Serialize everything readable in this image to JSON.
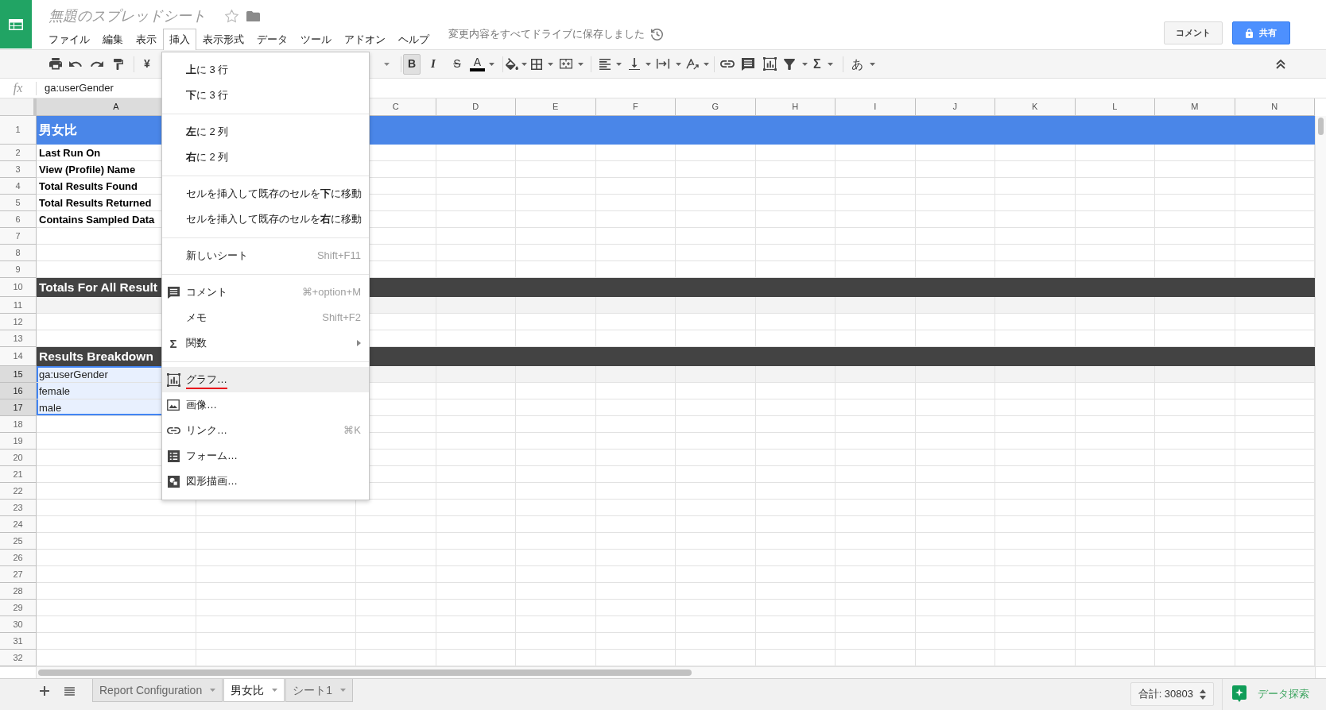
{
  "document": {
    "title": "無題のスプレッドシート",
    "starred": false,
    "save_status": "変更内容をすべてドライブに保存しました"
  },
  "menubar": [
    {
      "label": "ファイル",
      "open": false
    },
    {
      "label": "編集",
      "open": false
    },
    {
      "label": "表示",
      "open": false
    },
    {
      "label": "挿入",
      "open": true
    },
    {
      "label": "表示形式",
      "open": false
    },
    {
      "label": "データ",
      "open": false
    },
    {
      "label": "ツール",
      "open": false
    },
    {
      "label": "アドオン",
      "open": false
    },
    {
      "label": "ヘルプ",
      "open": false
    }
  ],
  "header_buttons": {
    "comment": "コメント",
    "share": "共有"
  },
  "toolbar": {
    "currency": "¥",
    "format_buttons": [
      {
        "kind": "bold",
        "glyph": "B",
        "active": true
      },
      {
        "kind": "italic",
        "glyph": "I",
        "active": false
      },
      {
        "kind": "strike",
        "glyph": "S",
        "active": false
      }
    ],
    "text_color": {
      "glyph": "A",
      "color": "#000000"
    },
    "functions_glyph": "Σ",
    "input_tools_glyph": "あ"
  },
  "formula_bar": {
    "label": "fx",
    "value": "ga:userGender"
  },
  "columns": [
    {
      "label": "A",
      "selected": true
    },
    {
      "label": "C",
      "selected": false
    },
    {
      "label": "D",
      "selected": false
    },
    {
      "label": "E",
      "selected": false
    },
    {
      "label": "F",
      "selected": false
    },
    {
      "label": "G",
      "selected": false
    },
    {
      "label": "H",
      "selected": false
    },
    {
      "label": "I",
      "selected": false
    },
    {
      "label": "J",
      "selected": false
    },
    {
      "label": "K",
      "selected": false
    },
    {
      "label": "L",
      "selected": false
    },
    {
      "label": "M",
      "selected": false
    },
    {
      "label": "N",
      "selected": false
    }
  ],
  "rows": [
    {
      "number": "1",
      "kind": "title",
      "selected": false,
      "value": "男女比"
    },
    {
      "number": "2",
      "kind": "label",
      "selected": false,
      "value": "Last Run On"
    },
    {
      "number": "3",
      "kind": "label",
      "selected": false,
      "value": "View (Profile) Name"
    },
    {
      "number": "4",
      "kind": "label",
      "selected": false,
      "value": "Total Results Found"
    },
    {
      "number": "5",
      "kind": "label",
      "selected": false,
      "value": "Total Results Returned"
    },
    {
      "number": "6",
      "kind": "label",
      "selected": false,
      "value": "Contains Sampled Data"
    },
    {
      "number": "7",
      "kind": "plain",
      "selected": false
    },
    {
      "number": "8",
      "kind": "plain",
      "selected": false
    },
    {
      "number": "9",
      "kind": "plain",
      "selected": false
    },
    {
      "number": "10",
      "kind": "section",
      "selected": false,
      "value": "Totals For All Result"
    },
    {
      "number": "11",
      "kind": "shaded",
      "selected": false
    },
    {
      "number": "12",
      "kind": "plain",
      "selected": false
    },
    {
      "number": "13",
      "kind": "plain",
      "selected": false
    },
    {
      "number": "14",
      "kind": "section",
      "selected": false,
      "value": "Results Breakdown"
    },
    {
      "number": "15",
      "kind": "shaded",
      "selected": true,
      "value": "ga:userGender"
    },
    {
      "number": "16",
      "kind": "plain",
      "selected": true,
      "value": "female"
    },
    {
      "number": "17",
      "kind": "plain",
      "selected": true,
      "value": "male"
    },
    {
      "number": "18",
      "kind": "plain",
      "selected": false
    },
    {
      "number": "19",
      "kind": "plain",
      "selected": false
    },
    {
      "number": "20",
      "kind": "plain",
      "selected": false
    },
    {
      "number": "21",
      "kind": "plain",
      "selected": false
    },
    {
      "number": "22",
      "kind": "plain",
      "selected": false
    },
    {
      "number": "23",
      "kind": "plain",
      "selected": false
    },
    {
      "number": "24",
      "kind": "plain",
      "selected": false
    },
    {
      "number": "25",
      "kind": "plain",
      "selected": false
    },
    {
      "number": "26",
      "kind": "plain",
      "selected": false
    },
    {
      "number": "27",
      "kind": "plain",
      "selected": false
    },
    {
      "number": "28",
      "kind": "plain",
      "selected": false
    },
    {
      "number": "29",
      "kind": "plain",
      "selected": false
    },
    {
      "number": "30",
      "kind": "plain",
      "selected": false
    },
    {
      "number": "31",
      "kind": "plain",
      "selected": false
    },
    {
      "number": "32",
      "kind": "plain",
      "selected": false
    }
  ],
  "insert_menu": {
    "groups": [
      {
        "items": [
          {
            "label": "**上**に 3 行",
            "highlighted": false,
            "underlined": false
          },
          {
            "label": "**下**に 3 行",
            "highlighted": false,
            "underlined": false
          }
        ]
      },
      {
        "items": [
          {
            "label": "**左**に 2 列",
            "highlighted": false,
            "underlined": false
          },
          {
            "label": "**右**に 2 列",
            "highlighted": false,
            "underlined": false
          }
        ]
      },
      {
        "items": [
          {
            "label": "セルを挿入して既存のセルを**下**に移動",
            "highlighted": false,
            "underlined": false
          },
          {
            "label": "セルを挿入して既存のセルを**右**に移動",
            "highlighted": false,
            "underlined": false
          }
        ]
      },
      {
        "items": [
          {
            "label": "新しいシート",
            "shortcut": "Shift+F11",
            "highlighted": false,
            "underlined": false
          }
        ]
      },
      {
        "items": [
          {
            "label": "コメント",
            "shortcut": "⌘+option+M",
            "highlighted": false,
            "underlined": false
          },
          {
            "label": "メモ",
            "shortcut": "Shift+F2",
            "highlighted": false,
            "underlined": false
          },
          {
            "label": "関数",
            "glyph": "Σ",
            "submenu": true,
            "highlighted": false,
            "underlined": false
          }
        ]
      },
      {
        "items": [
          {
            "label": "グラフ…",
            "highlighted": true,
            "underlined": true
          },
          {
            "label": "画像…",
            "highlighted": false,
            "underlined": false
          },
          {
            "label": "リンク…",
            "shortcut": "⌘K",
            "highlighted": false,
            "underlined": false
          },
          {
            "label": "フォーム…",
            "highlighted": false,
            "underlined": false
          },
          {
            "label": "図形描画…",
            "highlighted": false,
            "underlined": false
          }
        ]
      }
    ]
  },
  "sheets": [
    {
      "label": "Report Configuration",
      "selected": false
    },
    {
      "label": "男女比",
      "selected": true
    },
    {
      "label": "シート1",
      "selected": false
    }
  ],
  "status": {
    "sum": "合計: 30803",
    "explore": "データ探索"
  }
}
